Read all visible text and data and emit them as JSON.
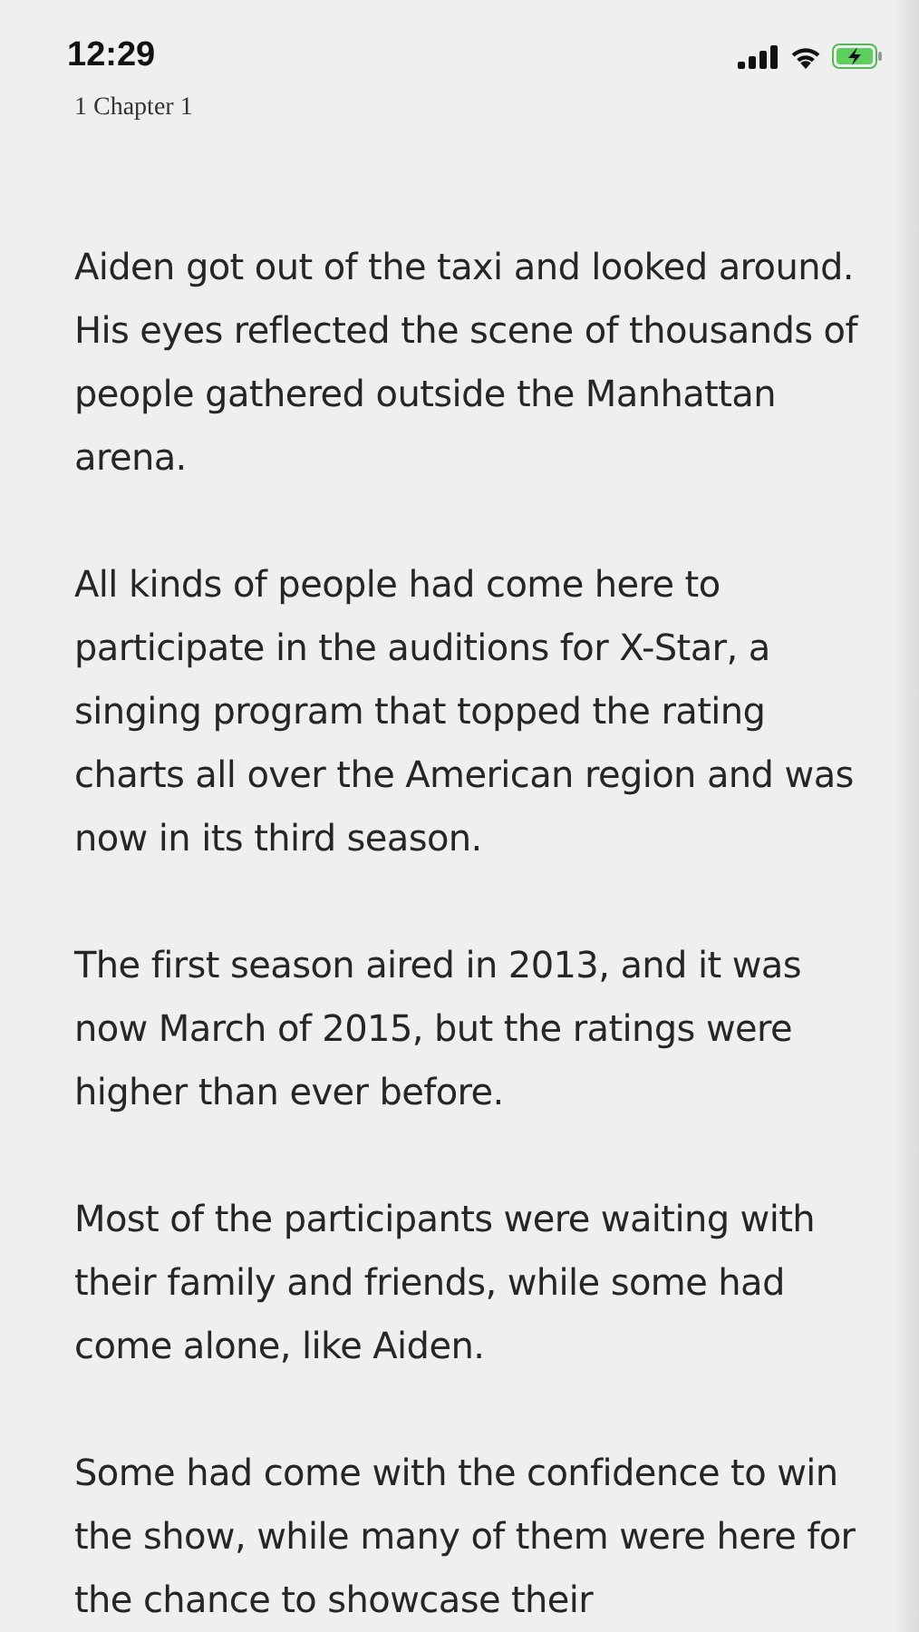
{
  "status_bar": {
    "time": "12:29",
    "battery_charging": true
  },
  "chapter_title": "1 Chapter 1",
  "paragraphs": [
    "Aiden got out of the taxi and looked around. His eyes reflected the scene of thousands of people gathered outside the Manhattan arena.",
    "All kinds of people had come here to participate in the auditions for X-Star, a singing program that topped the rating charts all over the American region and was now in its third season.",
    "The first season aired in 2013, and it was now March of 2015, but the ratings were higher than ever before.",
    "Most of the participants were waiting with their family and friends, while some had come alone, like Aiden.",
    "Some had come with the confidence to win the show, while many of them were here for the chance to showcase their"
  ]
}
